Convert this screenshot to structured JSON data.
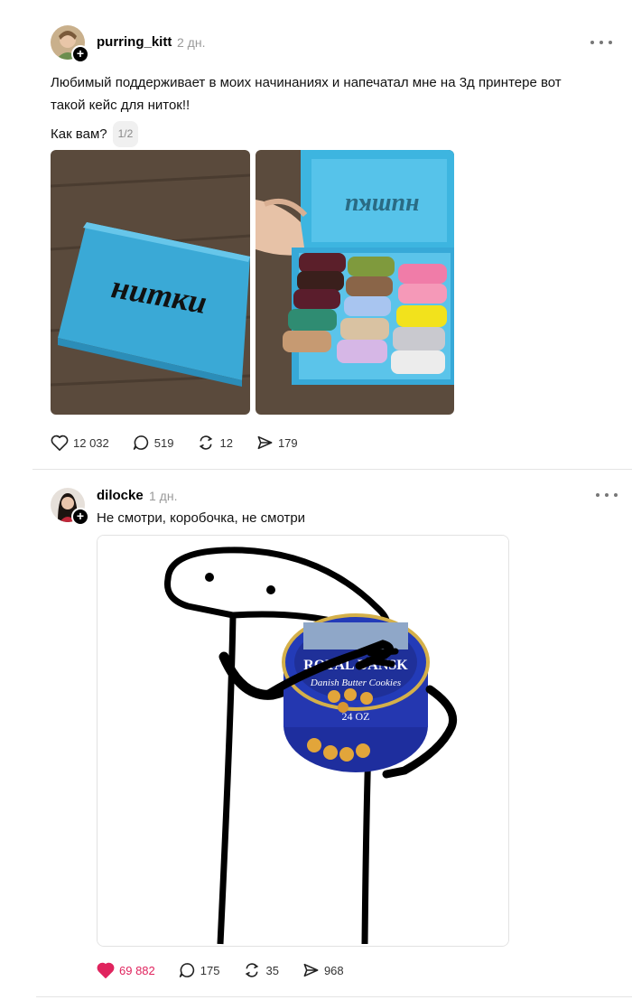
{
  "posts": [
    {
      "username": "purring_kitt",
      "time": "2 дн.",
      "text": "Любимый поддерживает в моих начинаниях и напечатал мне на 3д принтере вот такой кейс для ниток!!",
      "question": "Как вам?",
      "image_counter": "1/2",
      "box_lid_text": "нитки",
      "likes": "12 032",
      "comments": "519",
      "reposts": "12",
      "shares": "179",
      "liked": false
    },
    {
      "username": "dilocke",
      "time": "1 дн.",
      "text": "Не смотри, коробочка, не смотри",
      "tin_brand": "ROYAL DANSK",
      "tin_subtitle": "Danish Butter Cookies",
      "tin_weight": "24 OZ",
      "likes": "69 882",
      "comments": "175",
      "reposts": "35",
      "shares": "968",
      "liked": true
    }
  ],
  "colors": {
    "like_active": "#e0245e",
    "muted": "#999999",
    "divider": "#e4e4e4",
    "box_blue": "#3db5e0"
  },
  "icons": [
    "heart-icon",
    "comment-icon",
    "repost-icon",
    "share-icon",
    "more-icon",
    "plus-icon"
  ]
}
